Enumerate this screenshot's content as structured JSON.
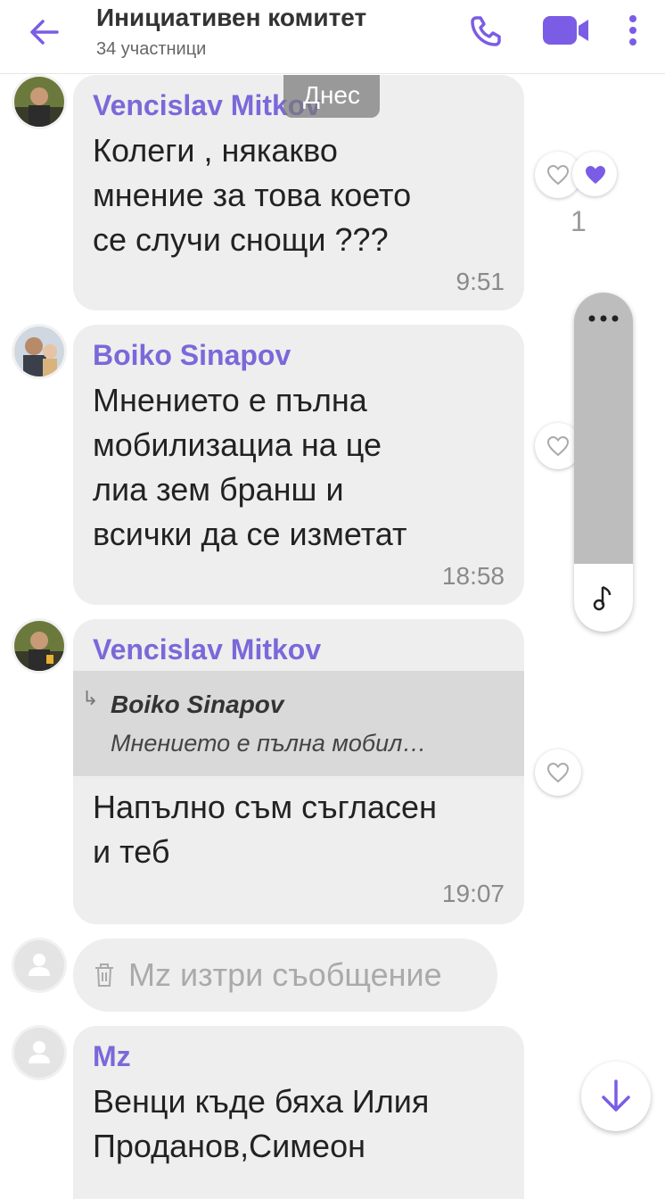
{
  "header": {
    "title": "Инициативен комитет",
    "subtitle": "34 участници",
    "accent": "#7b5ce5"
  },
  "day_separator": "Днес",
  "messages": [
    {
      "sender": "Vencislav Mitkov",
      "text": "Колеги , някакво\nмнение за това което\nсе случи снощи ???",
      "time": "9:51",
      "like_count": "1"
    },
    {
      "sender": "Boiko Sinapov",
      "text": "Мнението е пълна\nмобилизациа на це\nлиа зем бранш и\nвсички да се изметат",
      "time": "18:58"
    },
    {
      "sender": "Vencislav Mitkov",
      "reply_to_name": "Boiko Sinapov",
      "reply_to_text": "Мнението е пълна мобил…",
      "text": "Напълно съм съгласен\nи теб",
      "time": "19:07"
    },
    {
      "deleted_text": "Mz изтри съобщение"
    },
    {
      "sender": "Mz",
      "text": "Венци къде бяха Илия\nПроданов,Симеон"
    }
  ],
  "icons": {
    "back": "arrow-left-icon",
    "phone": "phone-icon",
    "video": "video-camera-icon",
    "menu": "more-vertical-icon",
    "heart": "heart-icon",
    "trash": "trash-icon",
    "more": "more-horizontal-icon",
    "music": "music-note-icon",
    "down": "arrow-down-icon"
  }
}
